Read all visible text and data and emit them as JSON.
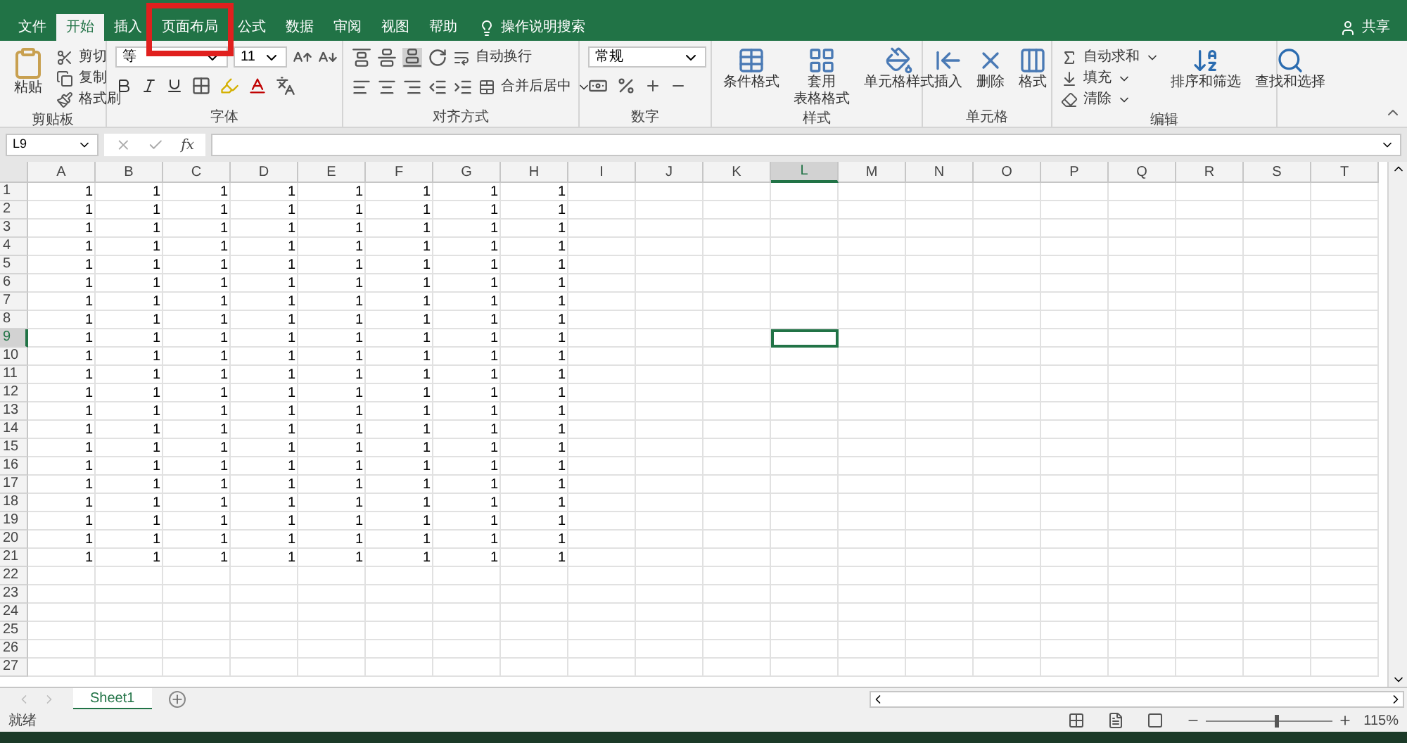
{
  "tabs": [
    {
      "label": "文件",
      "selected": false
    },
    {
      "label": "开始",
      "selected": true
    },
    {
      "label": "插入",
      "selected": false
    },
    {
      "label": "页面布局",
      "selected": false,
      "highlighted": true
    },
    {
      "label": "公式",
      "selected": false
    },
    {
      "label": "数据",
      "selected": false
    },
    {
      "label": "审阅",
      "selected": false
    },
    {
      "label": "视图",
      "selected": false
    },
    {
      "label": "帮助",
      "selected": false
    }
  ],
  "tell_me": "操作说明搜索",
  "share": "共享",
  "ribbon": {
    "clipboard": {
      "label": "剪贴板",
      "paste": "粘贴",
      "items": [
        "剪切",
        "复制",
        "格式刷"
      ]
    },
    "font": {
      "label": "字体",
      "font_name": "等",
      "font_size": "11"
    },
    "alignment": {
      "label": "对齐方式",
      "wrap": "自动换行",
      "merge": "合并后居中"
    },
    "number": {
      "label": "数字",
      "format": "常规"
    },
    "styles": {
      "label": "样式",
      "items": [
        [
          "条件格式"
        ],
        [
          "套用",
          "表格格式"
        ],
        [
          "单元格样式"
        ]
      ]
    },
    "cells": {
      "label": "单元格",
      "items": [
        "插入",
        "删除",
        "格式"
      ]
    },
    "editing": {
      "label": "编辑",
      "small": [
        "自动求和",
        "填充",
        "清除"
      ],
      "large": [
        "排序和筛选",
        "查找和选择"
      ]
    }
  },
  "formula_bar": {
    "name_box": "L9",
    "fx": "fx"
  },
  "sheet": {
    "columns": [
      {
        "label": "A",
        "selected": false
      },
      {
        "label": "B",
        "selected": false
      },
      {
        "label": "C",
        "selected": false
      },
      {
        "label": "D",
        "selected": false
      },
      {
        "label": "E",
        "selected": false
      },
      {
        "label": "F",
        "selected": false
      },
      {
        "label": "G",
        "selected": false
      },
      {
        "label": "H",
        "selected": false
      },
      {
        "label": "I",
        "selected": false
      },
      {
        "label": "J",
        "selected": false
      },
      {
        "label": "K",
        "selected": false
      },
      {
        "label": "L",
        "selected": true
      },
      {
        "label": "M",
        "selected": false
      },
      {
        "label": "N",
        "selected": false
      },
      {
        "label": "O",
        "selected": false
      },
      {
        "label": "P",
        "selected": false
      },
      {
        "label": "Q",
        "selected": false
      },
      {
        "label": "R",
        "selected": false
      },
      {
        "label": "S",
        "selected": false
      },
      {
        "label": "T",
        "selected": false
      }
    ],
    "rows": [
      {
        "label": "1",
        "selected": false,
        "cells": [
          "1",
          "1",
          "1",
          "1",
          "1",
          "1",
          "1",
          "1"
        ]
      },
      {
        "label": "2",
        "selected": false,
        "cells": [
          "1",
          "1",
          "1",
          "1",
          "1",
          "1",
          "1",
          "1"
        ]
      },
      {
        "label": "3",
        "selected": false,
        "cells": [
          "1",
          "1",
          "1",
          "1",
          "1",
          "1",
          "1",
          "1"
        ]
      },
      {
        "label": "4",
        "selected": false,
        "cells": [
          "1",
          "1",
          "1",
          "1",
          "1",
          "1",
          "1",
          "1"
        ]
      },
      {
        "label": "5",
        "selected": false,
        "cells": [
          "1",
          "1",
          "1",
          "1",
          "1",
          "1",
          "1",
          "1"
        ]
      },
      {
        "label": "6",
        "selected": false,
        "cells": [
          "1",
          "1",
          "1",
          "1",
          "1",
          "1",
          "1",
          "1"
        ]
      },
      {
        "label": "7",
        "selected": false,
        "cells": [
          "1",
          "1",
          "1",
          "1",
          "1",
          "1",
          "1",
          "1"
        ]
      },
      {
        "label": "8",
        "selected": false,
        "cells": [
          "1",
          "1",
          "1",
          "1",
          "1",
          "1",
          "1",
          "1"
        ]
      },
      {
        "label": "9",
        "selected": true,
        "cells": [
          "1",
          "1",
          "1",
          "1",
          "1",
          "1",
          "1",
          "1"
        ]
      },
      {
        "label": "10",
        "selected": false,
        "cells": [
          "1",
          "1",
          "1",
          "1",
          "1",
          "1",
          "1",
          "1"
        ]
      },
      {
        "label": "11",
        "selected": false,
        "cells": [
          "1",
          "1",
          "1",
          "1",
          "1",
          "1",
          "1",
          "1"
        ]
      },
      {
        "label": "12",
        "selected": false,
        "cells": [
          "1",
          "1",
          "1",
          "1",
          "1",
          "1",
          "1",
          "1"
        ]
      },
      {
        "label": "13",
        "selected": false,
        "cells": [
          "1",
          "1",
          "1",
          "1",
          "1",
          "1",
          "1",
          "1"
        ]
      },
      {
        "label": "14",
        "selected": false,
        "cells": [
          "1",
          "1",
          "1",
          "1",
          "1",
          "1",
          "1",
          "1"
        ]
      },
      {
        "label": "15",
        "selected": false,
        "cells": [
          "1",
          "1",
          "1",
          "1",
          "1",
          "1",
          "1",
          "1"
        ]
      },
      {
        "label": "16",
        "selected": false,
        "cells": [
          "1",
          "1",
          "1",
          "1",
          "1",
          "1",
          "1",
          "1"
        ]
      },
      {
        "label": "17",
        "selected": false,
        "cells": [
          "1",
          "1",
          "1",
          "1",
          "1",
          "1",
          "1",
          "1"
        ]
      },
      {
        "label": "18",
        "selected": false,
        "cells": [
          "1",
          "1",
          "1",
          "1",
          "1",
          "1",
          "1",
          "1"
        ]
      },
      {
        "label": "19",
        "selected": false,
        "cells": [
          "1",
          "1",
          "1",
          "1",
          "1",
          "1",
          "1",
          "1"
        ]
      },
      {
        "label": "20",
        "selected": false,
        "cells": [
          "1",
          "1",
          "1",
          "1",
          "1",
          "1",
          "1",
          "1"
        ]
      },
      {
        "label": "21",
        "selected": false,
        "cells": [
          "1",
          "1",
          "1",
          "1",
          "1",
          "1",
          "1",
          "1"
        ]
      },
      {
        "label": "22",
        "selected": false,
        "cells": []
      },
      {
        "label": "23",
        "selected": false,
        "cells": []
      },
      {
        "label": "24",
        "selected": false,
        "cells": []
      },
      {
        "label": "25",
        "selected": false,
        "cells": []
      },
      {
        "label": "26",
        "selected": false,
        "cells": []
      },
      {
        "label": "27",
        "selected": false,
        "cells": []
      }
    ]
  },
  "sheet_tabs": [
    {
      "label": "Sheet1",
      "selected": true
    }
  ],
  "status_bar": {
    "status": "就绪",
    "zoom": {
      "level": 0.55,
      "reading": "115%"
    }
  }
}
